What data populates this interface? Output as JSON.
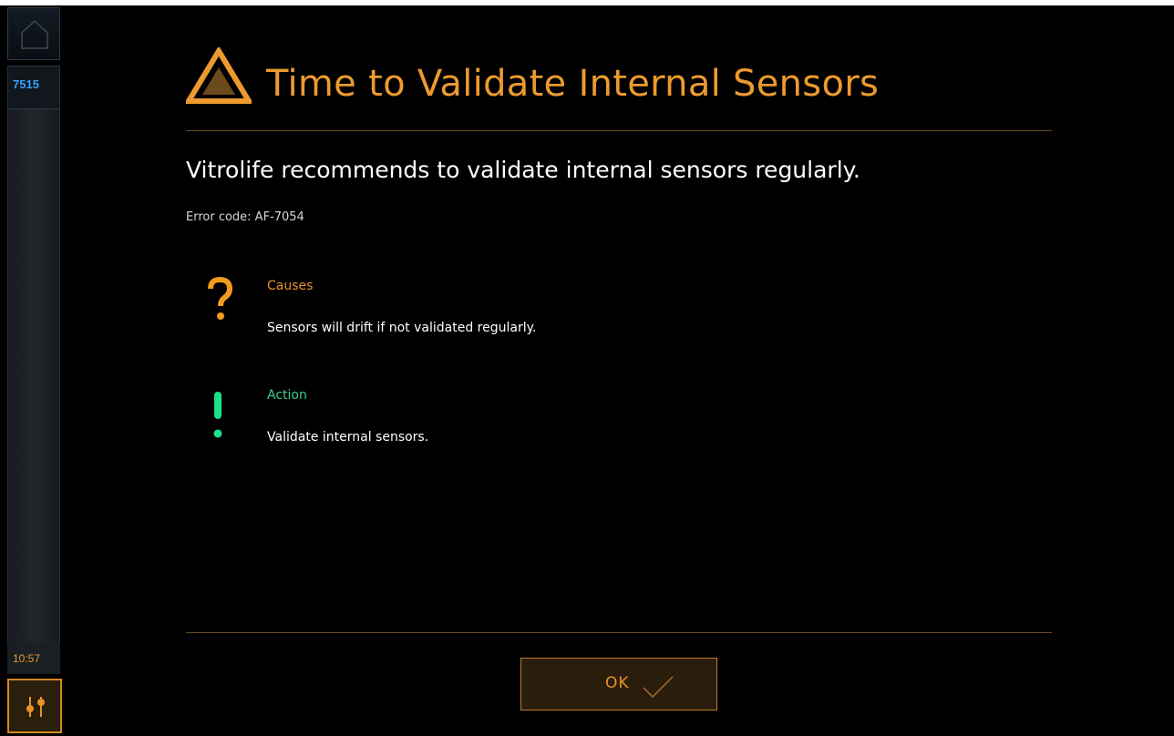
{
  "sidebar": {
    "home_icon": "home-icon",
    "incubator_id": "7515",
    "time": "10:57",
    "settings_icon": "sliders-icon"
  },
  "dialog": {
    "title": "Time to Validate Internal Sensors",
    "title_icon": "warning-triangle-icon",
    "message": "Vitrolife recommends to validate internal sensors regularly.",
    "error_code": "Error code: AF-7054",
    "causes": {
      "icon": "question-mark-icon",
      "heading": "Causes",
      "text": "Sensors will drift if not validated regularly."
    },
    "action": {
      "icon": "exclamation-icon",
      "heading": "Action",
      "text": "Validate internal sensors."
    },
    "ok_button": {
      "label": "OK",
      "icon": "checkmark-icon"
    }
  },
  "colors": {
    "background": "#000000",
    "accent_orange": "#ec9a2f",
    "action_green": "#3ccf88",
    "id_blue": "#3aa0ff"
  }
}
